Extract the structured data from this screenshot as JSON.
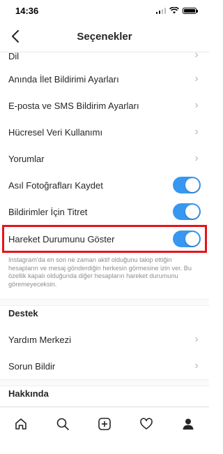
{
  "status_bar": {
    "time": "14:36"
  },
  "header": {
    "title": "Seçenekler"
  },
  "list_items": [
    {
      "label": "Dil"
    },
    {
      "label": "Anında İlet Bildirimi Ayarları"
    },
    {
      "label": "E-posta ve SMS Bildirim Ayarları"
    },
    {
      "label": "Hücresel Veri Kullanımı"
    },
    {
      "label": "Yorumlar"
    }
  ],
  "toggles": [
    {
      "label": "Asıl Fotoğrafları Kaydet",
      "on": true
    },
    {
      "label": "Bildirimler İçin Titret",
      "on": true
    },
    {
      "label": "Hareket Durumunu Göster",
      "on": true
    }
  ],
  "activity_description": "Instagram'da en son ne zaman aktif olduğunu takip ettiğin hesapların ve mesaj gönderdiğin herkesin görmesine izin ver. Bu özellik kapalı olduğunda diğer hesapların hareket durumunu göremeyeceksin.",
  "support": {
    "title": "Destek",
    "items": [
      {
        "label": "Yardım Merkezi"
      },
      {
        "label": "Sorun Bildir"
      }
    ]
  },
  "about": {
    "title": "Hakkında"
  },
  "colors": {
    "accent": "#3897f0",
    "highlight": "#e8121b"
  },
  "tabbar": [
    "home-icon",
    "search-icon",
    "add-post-icon",
    "activity-heart-icon",
    "profile-icon"
  ]
}
